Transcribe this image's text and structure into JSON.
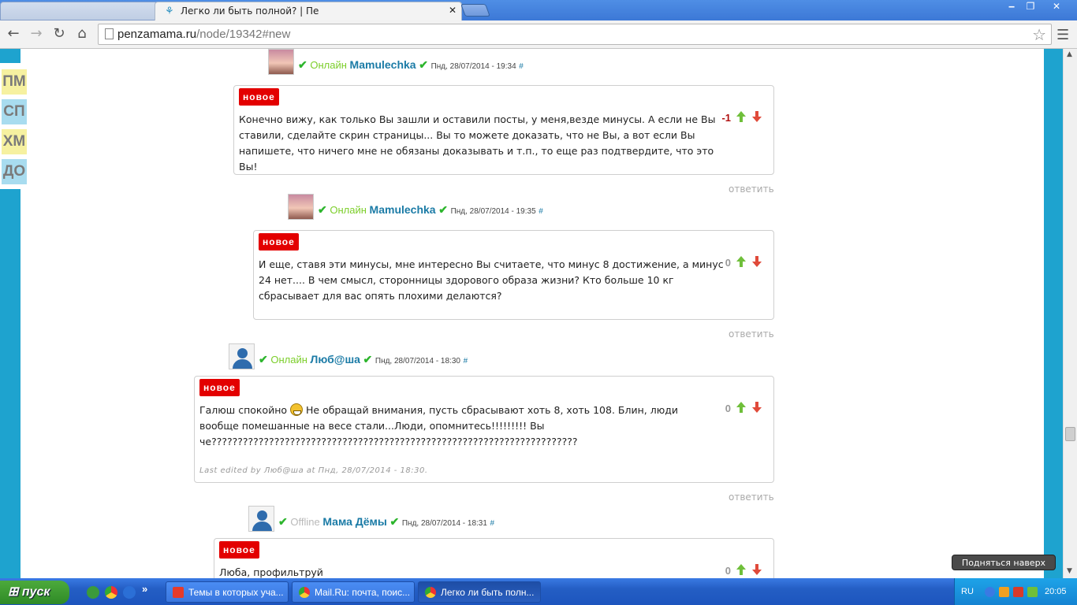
{
  "browser": {
    "active_tab_title": "Легко ли быть полной? | Пе",
    "url_domain": "penzamama.ru",
    "url_path": "/node/19342#new",
    "window_buttons": [
      "‒",
      "❐",
      "✕"
    ]
  },
  "sidenav": [
    "ПМ",
    "СП",
    "ХМ",
    "ДО"
  ],
  "comments": [
    {
      "status": "Онлайн",
      "user": "Mamulechka",
      "date": "Пнд, 28/07/2014 - 19:34",
      "hash": "#",
      "badge": "новое",
      "text": "Конечно вижу, как только Вы зашли и оставили посты, у меня,везде минусы. А если не Вы ставили, сделайте скрин страницы... Вы то можете доказать, что не Вы, а вот если Вы напишете, что ничего мне не обязаны доказывать и т.п., то еще раз подтвердите, что это Вы!",
      "score": "-1",
      "reply": "ответить"
    },
    {
      "status": "Онлайн",
      "user": "Mamulechka",
      "date": "Пнд, 28/07/2014 - 19:35",
      "hash": "#",
      "badge": "новое",
      "text": "И еще, ставя эти минусы, мне интересно Вы считаете, что минус 8 достижение, а минус 24 нет.... В чем смысл, сторонницы здорового образа жизни? Кто больше 10 кг сбрасывает для вас опять плохими делаются?",
      "score": "0",
      "reply": "ответить"
    },
    {
      "status": "Онлайн",
      "user": "Люб@ша",
      "date": "Пнд, 28/07/2014 - 18:30",
      "hash": "#",
      "badge": "новое",
      "text_before_smiley": "Галюш спокойно",
      "text_after_smiley": " Не обращай внимания, пусть сбрасывают хоть 8, хоть 108. Блин, люди вообще помешанные на весе стали...Люди, опомнитесь!!!!!!!!! Вы че??????????????????????????????????????????????????????????????????????",
      "edited": "Last edited by Люб@ша at Пнд, 28/07/2014 - 18:30.",
      "score": "0",
      "reply": "ответить"
    },
    {
      "status": "Offline",
      "user": "Мама Дёмы",
      "date": "Пнд, 28/07/2014 - 18:31",
      "hash": "#",
      "badge": "новое",
      "text": "Люба, профильтруй",
      "score": "0"
    }
  ],
  "back_to_top": "Подняться наверх",
  "taskbar": {
    "start": "пуск",
    "overflow": "»",
    "tasks": [
      "Темы в которых уча...",
      "Mail.Ru: почта, поис...",
      "Легко ли быть полн..."
    ],
    "lang": "RU",
    "clock": "20:05"
  }
}
